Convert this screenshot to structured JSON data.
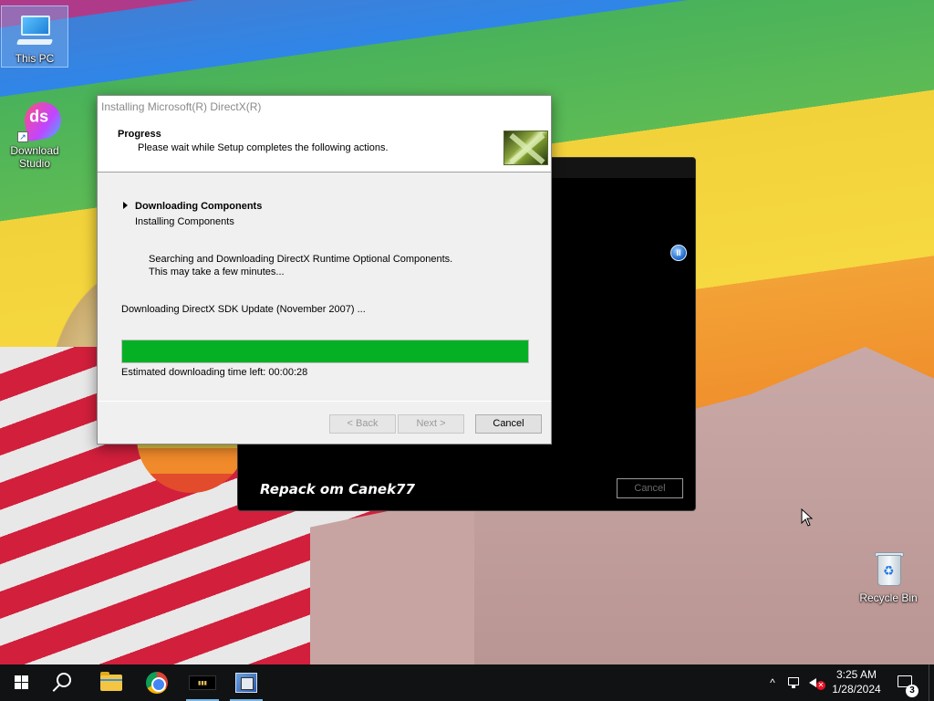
{
  "desktop": {
    "icons": [
      {
        "label": "This PC"
      },
      {
        "label": "Download Studio"
      },
      {
        "label": "Recycle Bin"
      }
    ]
  },
  "background_installer": {
    "repack_label": "Repack om Canek77",
    "cancel_label": "Cancel",
    "pause_icon": "pause-icon"
  },
  "directx_dialog": {
    "window_title": "Installing Microsoft(R) DirectX(R)",
    "header_title": "Progress",
    "header_subtitle": "Please wait while Setup completes the following actions.",
    "step_title": "Downloading Components",
    "step_subtitle": "Installing Components",
    "info_line1": "Searching and Downloading DirectX Runtime Optional Components.",
    "info_line2": "This may take a few minutes...",
    "status_text": "Downloading DirectX SDK Update (November 2007) ...",
    "progress_fraction": 1.0,
    "progress_color": "#06b025",
    "eta_text": "Estimated downloading time left: 00:00:28",
    "buttons": {
      "back": "< Back",
      "next": "Next >",
      "cancel": "Cancel"
    }
  },
  "taskbar": {
    "apps": [
      {
        "icon": "windows-start-icon"
      },
      {
        "icon": "search-icon"
      },
      {
        "icon": "file-explorer-icon"
      },
      {
        "icon": "chrome-icon"
      },
      {
        "icon": "game-app-icon"
      },
      {
        "icon": "setup-app-icon"
      }
    ],
    "tray": {
      "chevron": "^",
      "time": "3:25 AM",
      "date": "1/28/2024",
      "notification_count": "3"
    }
  }
}
